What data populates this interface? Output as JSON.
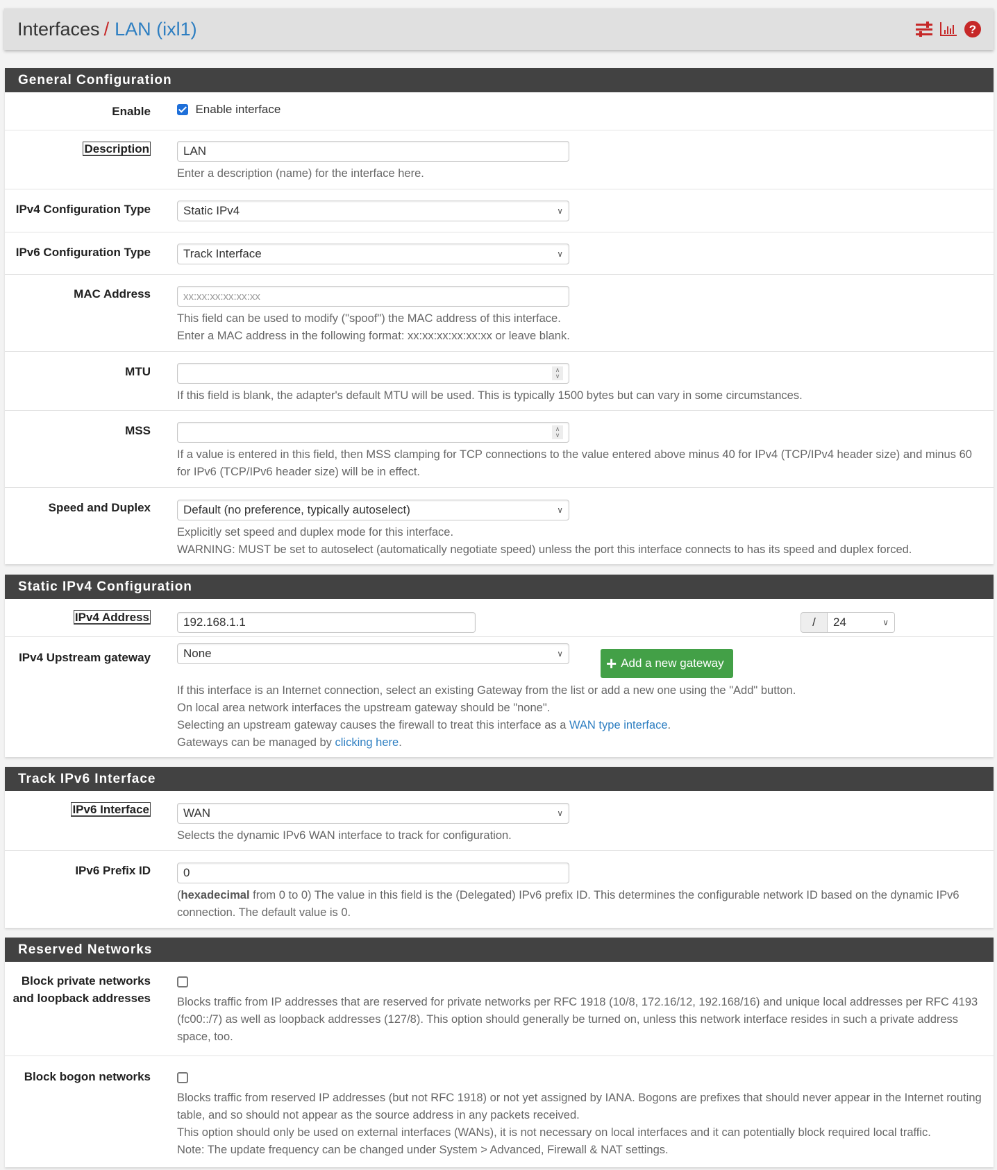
{
  "header": {
    "breadcrumb_root": "Interfaces",
    "breadcrumb_separator": "/",
    "breadcrumb_current": "LAN (ixl1)",
    "icons": [
      "sliders-icon",
      "bar-chart-icon",
      "help-icon"
    ],
    "accent_color": "#c62828",
    "link_color": "#2d7ec1"
  },
  "general": {
    "title": "General Configuration",
    "enable": {
      "label": "Enable",
      "checkbox_label": "Enable interface",
      "checked": true
    },
    "description": {
      "label": "Description",
      "value": "LAN",
      "help": "Enter a description (name) for the interface here."
    },
    "ipv4_type": {
      "label": "IPv4 Configuration Type",
      "value": "Static IPv4"
    },
    "ipv6_type": {
      "label": "IPv6 Configuration Type",
      "value": "Track Interface"
    },
    "mac": {
      "label": "MAC Address",
      "placeholder": "xx:xx:xx:xx:xx:xx",
      "value": "",
      "help1": "This field can be used to modify (\"spoof\") the MAC address of this interface.",
      "help2": "Enter a MAC address in the following format: xx:xx:xx:xx:xx:xx or leave blank."
    },
    "mtu": {
      "label": "MTU",
      "value": "",
      "help": "If this field is blank, the adapter's default MTU will be used. This is typically 1500 bytes but can vary in some circumstances."
    },
    "mss": {
      "label": "MSS",
      "value": "",
      "help": "If a value is entered in this field, then MSS clamping for TCP connections to the value entered above minus 40 for IPv4 (TCP/IPv4 header size) and minus 60 for IPv6 (TCP/IPv6 header size) will be in effect."
    },
    "speed": {
      "label": "Speed and Duplex",
      "value": "Default (no preference, typically autoselect)",
      "help1": "Explicitly set speed and duplex mode for this interface.",
      "help2": "WARNING: MUST be set to autoselect (automatically negotiate speed) unless the port this interface connects to has its speed and duplex forced."
    }
  },
  "static_ipv4": {
    "title": "Static IPv4 Configuration",
    "address": {
      "label": "IPv4 Address",
      "value": "192.168.1.1",
      "slash": "/",
      "cidr": "24"
    },
    "gateway": {
      "label": "IPv4 Upstream gateway",
      "value": "None",
      "add_button": "Add a new gateway",
      "help1": "If this interface is an Internet connection, select an existing Gateway from the list or add a new one using the \"Add\" button.",
      "help2": "On local area network interfaces the upstream gateway should be \"none\".",
      "help3_prefix": "Selecting an upstream gateway causes the firewall to treat this interface as a ",
      "help3_link": "WAN type interface",
      "help3_suffix": ".",
      "help4_prefix": "Gateways can be managed by ",
      "help4_link": "clicking here",
      "help4_suffix": "."
    }
  },
  "track_ipv6": {
    "title": "Track IPv6 Interface",
    "interface": {
      "label": "IPv6 Interface",
      "value": "WAN",
      "help": "Selects the dynamic IPv6 WAN interface to track for configuration."
    },
    "prefix_id": {
      "label": "IPv6 Prefix ID",
      "value": "0",
      "help_bold": "hexadecimal",
      "help_open": "(",
      "help_rest": " from 0 to 0) The value in this field is the (Delegated) IPv6 prefix ID. This determines the configurable network ID based on the dynamic IPv6 connection. The default value is 0."
    }
  },
  "reserved": {
    "title": "Reserved Networks",
    "block_private": {
      "label_line1": "Block private networks",
      "label_line2": "and loopback addresses",
      "checked": false,
      "help": "Blocks traffic from IP addresses that are reserved for private networks per RFC 1918 (10/8, 172.16/12, 192.168/16) and unique local addresses per RFC 4193 (fc00::/7) as well as loopback addresses (127/8). This option should generally be turned on, unless this network interface resides in such a private address space, too."
    },
    "block_bogon": {
      "label": "Block bogon networks",
      "checked": false,
      "help1": "Blocks traffic from reserved IP addresses (but not RFC 1918) or not yet assigned by IANA. Bogons are prefixes that should never appear in the Internet routing table, and so should not appear as the source address in any packets received.",
      "help2": "This option should only be used on external interfaces (WANs), it is not necessary on local interfaces and it can potentially block required local traffic.",
      "help3": "Note: The update frequency can be changed under System > Advanced, Firewall & NAT settings."
    }
  }
}
